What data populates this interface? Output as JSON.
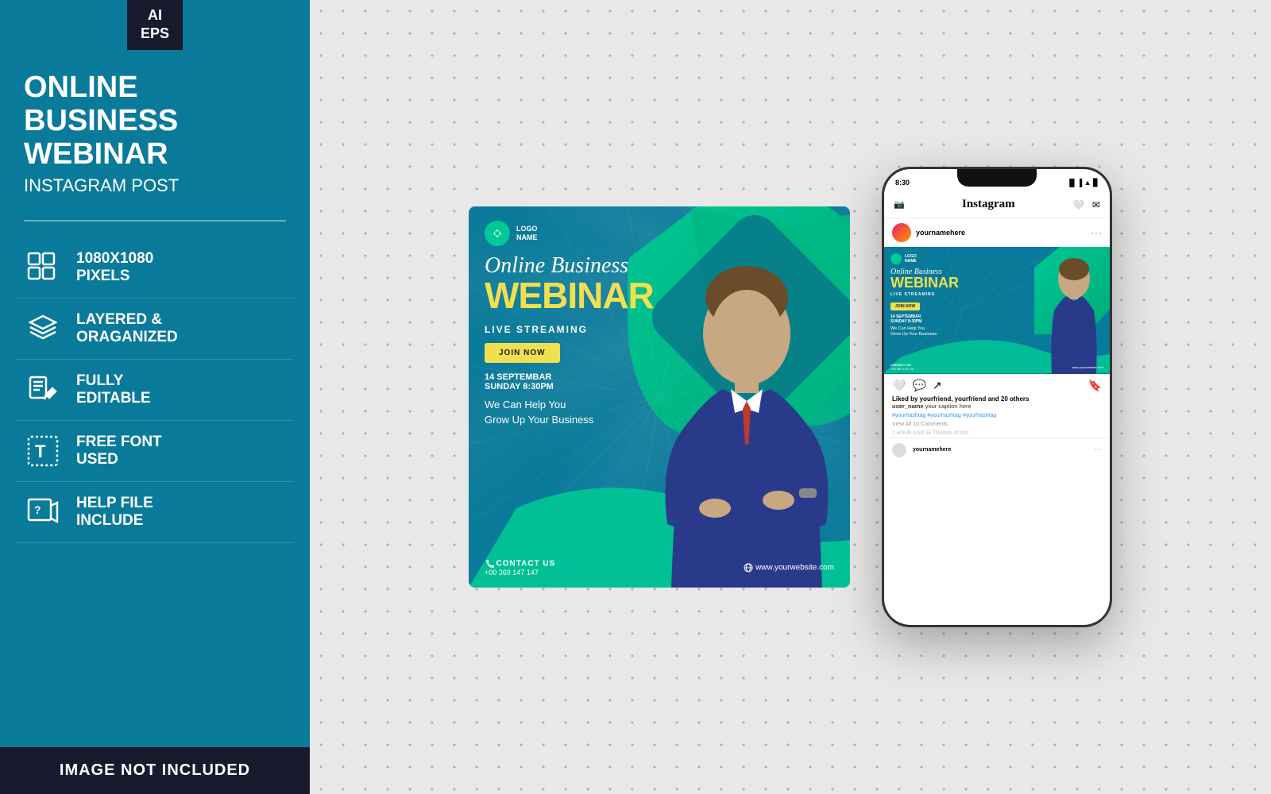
{
  "sidebar": {
    "badge": "AI\nEPS",
    "title": "ONLINE BUSINESS\nWEBINAR",
    "subtitle": "INSTAGRAM POST",
    "features": [
      {
        "id": "resolution",
        "icon": "grid-icon",
        "text": "1080x1080\nPIXELS"
      },
      {
        "id": "layered",
        "icon": "layers-icon",
        "text": "LAYERED &\nORAGANIZED"
      },
      {
        "id": "editable",
        "icon": "edit-icon",
        "text": "FULLY\nEDITABLE"
      },
      {
        "id": "font",
        "icon": "font-icon",
        "text": "FREE FONT\nUSED"
      },
      {
        "id": "help",
        "icon": "help-icon",
        "text": "HELP FILE\nINCLUDE"
      }
    ],
    "footer_text": "IMAGE NOT INCLUDED"
  },
  "poster": {
    "logo_name": "LOGO\nNAME",
    "title_script": "Online Business",
    "title_bold": "WEBINAR",
    "live": "LIVE STREAMING",
    "join_btn": "JOIN NOW",
    "date_line1": "14 SEPTEMBAR",
    "date_line2": "SUNDAY 8:30PM",
    "tagline": "We Can Help You\nGrow Up Your Business",
    "contact_label": "CONTACT US",
    "contact_phone": "+00 369 147 147",
    "website": "www.yourwebsite.com"
  },
  "phone": {
    "status_time": "8:30",
    "app_name": "Instagram",
    "username": "yournamehere",
    "liked_by": "Liked by yourfriend, yourfriend and 20 others",
    "caption_user": "user_name",
    "caption_text": "your caption here",
    "hashtags": "#yourhashtag #yourhashtag #yourhashtag",
    "view_comments": "View All 10 Comments",
    "time_ago": "1 HOUR AGO   55 TRANSLATION",
    "comment_username": "yournamehere"
  },
  "colors": {
    "teal": "#0a7a9a",
    "dark_navy": "#1a1a2e",
    "green": "#00c896",
    "yellow": "#f0e050",
    "bg_dots": "#e0e0e0"
  }
}
